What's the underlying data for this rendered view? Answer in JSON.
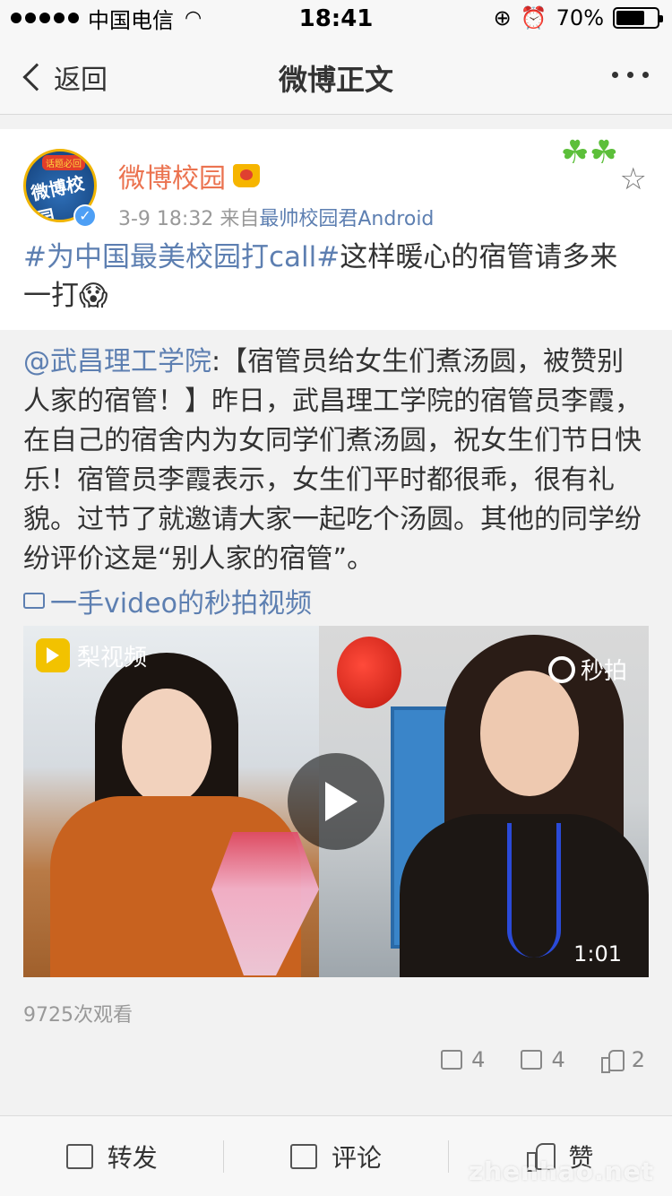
{
  "status_bar": {
    "carrier": "中国电信",
    "time": "18:41",
    "battery_text": "70%",
    "battery_level": 0.7
  },
  "nav": {
    "back_label": "返回",
    "title": "微博正文"
  },
  "post": {
    "avatar_badge": "话题必回",
    "avatar_text": "微博校园",
    "username": "微博校园",
    "time": "3-9 18:32",
    "source_prefix": "来自",
    "source": "最帅校园君Android",
    "topic": "#为中国最美校园打call#",
    "text": "这样暖心的宿管请多来一打",
    "emoji": "😱"
  },
  "repost": {
    "mention": "@武昌理工学院",
    "text": ":【宿管员给女生们煮汤圆，被赞别人家的宿管！】昨日，武昌理工学院的宿管员李霞，在自己的宿舍内为女同学们煮汤圆，祝女生们节日快乐！宿管员李霞表示，女生们平时都很乖，很有礼貌。过节了就邀请大家一起吃个汤圆。其他的同学纷纷评价这是“别人家的宿管”。",
    "video_link": "一手video的秒拍视频",
    "video": {
      "watermark_left": "梨视频",
      "watermark_right": "秒拍",
      "duration": "1:01"
    },
    "view_count": "9725次观看",
    "stats": {
      "reposts": "4",
      "comments": "4",
      "likes": "2"
    }
  },
  "toolbar": {
    "repost_label": "转发",
    "comment_label": "评论",
    "like_label": "赞"
  },
  "site_watermark": "zhenhao.net"
}
